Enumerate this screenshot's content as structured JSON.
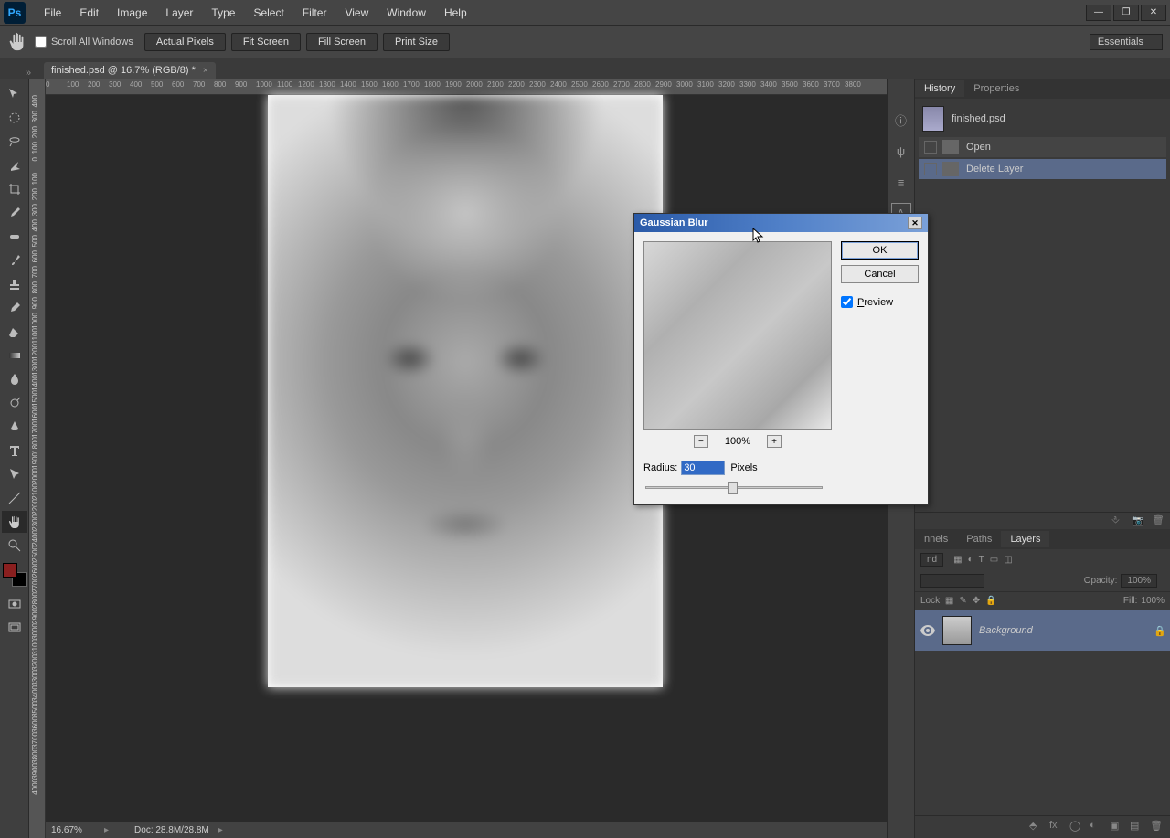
{
  "menu": {
    "items": [
      "File",
      "Edit",
      "Image",
      "Layer",
      "Type",
      "Select",
      "Filter",
      "View",
      "Window",
      "Help"
    ]
  },
  "options": {
    "scroll_all": "Scroll All Windows",
    "actual_pixels": "Actual Pixels",
    "fit_screen": "Fit Screen",
    "fill_screen": "Fill Screen",
    "print_size": "Print Size",
    "workspace": "Essentials"
  },
  "tab": {
    "title": "finished.psd @ 16.7% (RGB/8) *"
  },
  "ruler": {
    "h": [
      "0",
      "100",
      "200",
      "300",
      "400",
      "500",
      "600",
      "700",
      "800",
      "900",
      "1000",
      "1100",
      "1200",
      "1300",
      "1400",
      "1500",
      "1600",
      "1700",
      "1800",
      "1900",
      "2000",
      "2100",
      "2200",
      "2300",
      "2400",
      "2500",
      "2600",
      "2700",
      "2800",
      "2900",
      "3000",
      "3100",
      "3200",
      "3300",
      "3400",
      "3500",
      "3600",
      "3700",
      "3800"
    ],
    "v": [
      "400",
      "300",
      "200",
      "100",
      "0",
      "100",
      "200",
      "300",
      "400",
      "500",
      "600",
      "700",
      "800",
      "900",
      "1000",
      "1100",
      "1200",
      "1300",
      "1400",
      "1500",
      "1600",
      "1700",
      "1800",
      "1900",
      "2000",
      "2100",
      "2200",
      "2300",
      "2400",
      "2500",
      "2600",
      "2700",
      "2800",
      "2900",
      "3000",
      "3100",
      "3200",
      "3300",
      "3400",
      "3500",
      "3600",
      "3700",
      "3800",
      "3900",
      "4000"
    ]
  },
  "status": {
    "zoom": "16.67%",
    "doc": "Doc: 28.8M/28.8M"
  },
  "panels": {
    "history_tab": "History",
    "properties_tab": "Properties",
    "history_doc": "finished.psd",
    "history_items": [
      "Open",
      "Delete Layer"
    ],
    "channels_tab": "nnels",
    "paths_tab": "Paths",
    "layers_tab": "Layers",
    "blend": "nd",
    "opacity_label": "Opacity:",
    "opacity_value": "100%",
    "lock_label": "Lock:",
    "fill_label": "Fill:",
    "fill_value": "100%",
    "layer_name": "Background"
  },
  "dialog": {
    "title": "Gaussian Blur",
    "ok": "OK",
    "cancel": "Cancel",
    "preview": "Preview",
    "zoom": "100%",
    "radius_label": "Radius:",
    "radius_value": "30",
    "radius_unit": "Pixels"
  }
}
